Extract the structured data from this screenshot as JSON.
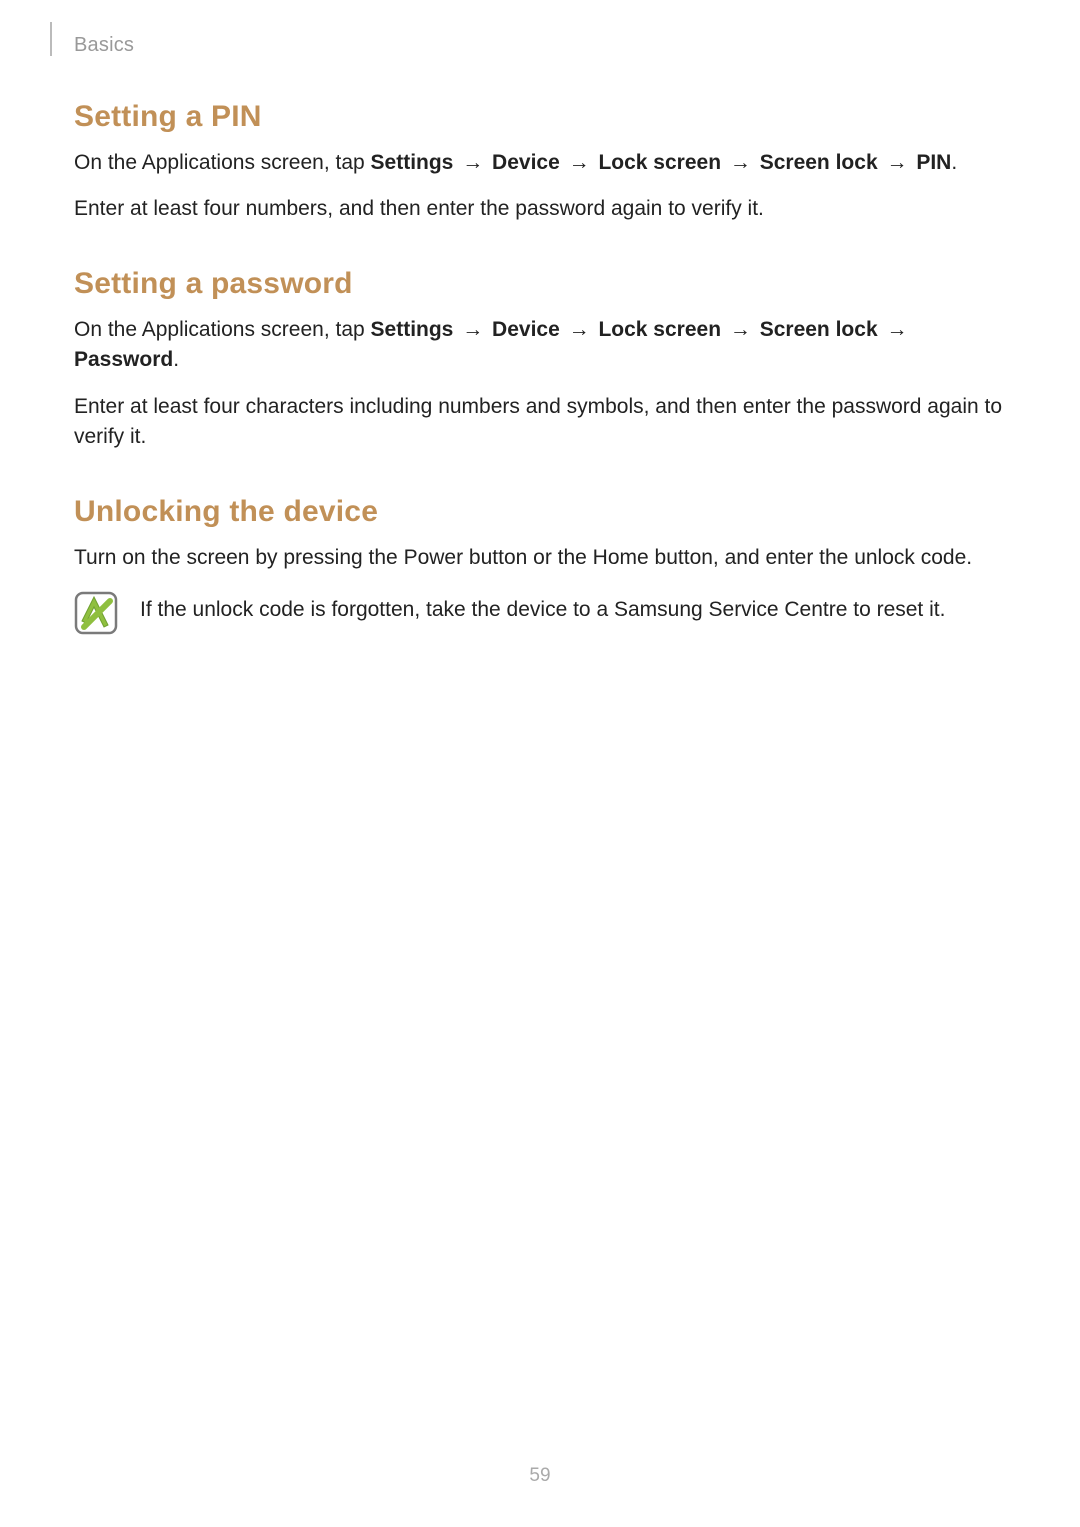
{
  "header": {
    "section": "Basics"
  },
  "sections": [
    {
      "heading": "Setting a PIN",
      "p1_lead": "On the Applications screen, tap ",
      "path": [
        "Settings",
        "Device",
        "Lock screen",
        "Screen lock",
        "PIN"
      ],
      "p1_tail": ".",
      "p2": "Enter at least four numbers, and then enter the password again to verify it."
    },
    {
      "heading": "Setting a password",
      "p1_lead": "On the Applications screen, tap ",
      "path": [
        "Settings",
        "Device",
        "Lock screen",
        "Screen lock",
        "Password"
      ],
      "p1_tail": ".",
      "p2": "Enter at least four characters including numbers and symbols, and then enter the password again to verify it."
    },
    {
      "heading": "Unlocking the device",
      "p1": "Turn on the screen by pressing the Power button or the Home button, and enter the unlock code.",
      "note": "If the unlock code is forgotten, take the device to a Samsung Service Centre to reset it."
    }
  ],
  "arrow": "→",
  "page_number": "59",
  "colors": {
    "heading": "#c19057",
    "note_icon_border": "#7a7a7a",
    "note_icon_fill": "#8fbf3f"
  }
}
